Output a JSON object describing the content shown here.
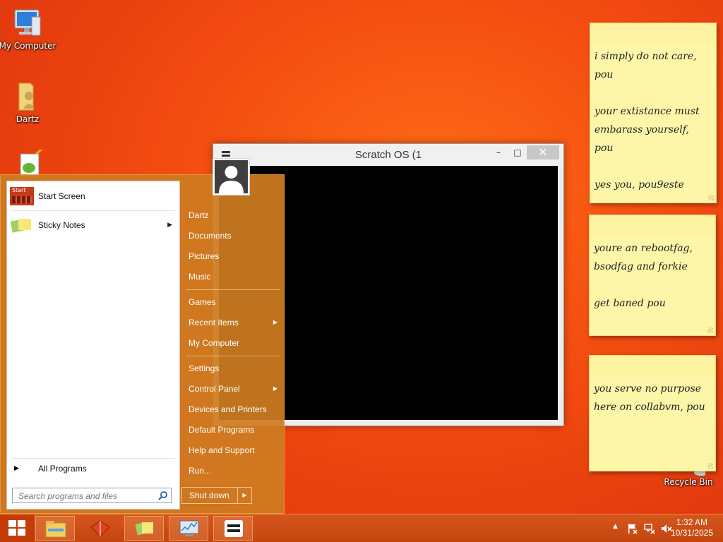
{
  "desktop": {
    "icons": [
      {
        "label": "My Computer",
        "icon": "computer-icon"
      },
      {
        "label": "Dartz",
        "icon": "user-folder-icon"
      },
      {
        "label": "Recycle Bin",
        "icon": "recycle-bin-icon"
      }
    ]
  },
  "sticky_notes": [
    {
      "text": "i simply do not care,\npou\n\nyour extistance must\nembarass yourself,\npou\n\nyes you, pou9este"
    },
    {
      "text": "youre an rebootfag,\nbsodfag and forkie\n\nget baned pou"
    },
    {
      "text": "you serve no purpose\nhere on collabvm, pou"
    }
  ],
  "window": {
    "title": "Scratch OS (1",
    "minimize": "–",
    "maximize": "□",
    "close": "✕"
  },
  "start_menu": {
    "start_icon_label": "Start",
    "pinned": [
      {
        "label": "Start Screen"
      },
      {
        "label": "Sticky Notes"
      }
    ],
    "all_programs": "All Programs",
    "search_placeholder": "Search programs and files",
    "right_items": [
      {
        "label": "Dartz"
      },
      {
        "label": "Documents"
      },
      {
        "label": "Pictures"
      },
      {
        "label": "Music"
      },
      {
        "label": "Games"
      },
      {
        "label": "Recent Items"
      },
      {
        "label": "My Computer"
      },
      {
        "label": "Settings"
      },
      {
        "label": "Control Panel"
      },
      {
        "label": "Devices and Printers"
      },
      {
        "label": "Default Programs"
      },
      {
        "label": "Help and Support"
      },
      {
        "label": "Run..."
      }
    ],
    "shutdown_label": "Shut down"
  },
  "taskbar": {
    "buttons": [
      {
        "icon": "file-explorer-icon"
      },
      {
        "icon": "app-red-icon"
      },
      {
        "icon": "sticky-notes-icon"
      },
      {
        "icon": "performance-monitor-icon"
      },
      {
        "icon": "scratch-os-icon"
      }
    ],
    "clock_time": "1:32 AM",
    "clock_date": "10/31/2025"
  },
  "colors": {
    "desktop_orange": "#f24a10",
    "start_menu_amber": "#ce7c20",
    "note_yellow": "#fdf6a8"
  }
}
